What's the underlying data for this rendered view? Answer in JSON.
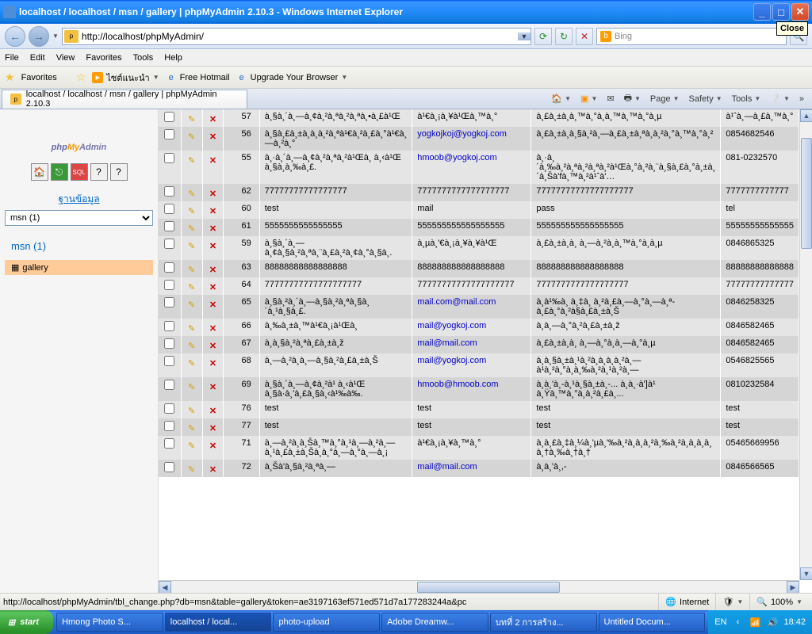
{
  "window": {
    "title": "localhost / localhost / msn / gallery | phpMyAdmin 2.10.3 - Windows Internet Explorer",
    "close_tip": "Close"
  },
  "nav": {
    "url": "http://localhost/phpMyAdmin/",
    "search_provider": "Bing"
  },
  "menu": {
    "file": "File",
    "edit": "Edit",
    "view": "View",
    "favorites": "Favorites",
    "tools": "Tools",
    "help": "Help"
  },
  "favbar": {
    "favorites": "Favorites",
    "suggested": "ไซต์แนะนำ",
    "hotmail": "Free Hotmail",
    "upgrade": "Upgrade Your Browser"
  },
  "tab": {
    "title": "localhost / localhost / msn / gallery | phpMyAdmin 2.10.3"
  },
  "cmdbar": {
    "page": "Page",
    "safety": "Safety",
    "tools": "Tools"
  },
  "sidebar": {
    "db_label": "ฐานข้อมูล",
    "db_selected": "msn (1)",
    "link": "msn (1)",
    "table": "gallery"
  },
  "rows": [
    {
      "id": "57",
      "c1": "à¸§à¸´à¸—à¸¢à¸²à¸ªà¸²à¸ªà¸•à¸£à¹Œ",
      "c2": "à¹€à¸¡à¸¥à¹Œà¸™à¸°",
      "c3": "à¸£à¸±à¸à¸™à¸°à¸à¸™à¸™à¸°à¸µ",
      "c4": "à¹ˆà¸—à¸£à¸™à¸°"
    },
    {
      "id": "56",
      "c1": "à¸§à¸£à¸±à¸à¸à¸²à¸ªà¹€à¸²à¸£à¸°à¹€à¸—à¸²à¸°",
      "c2": "yogkojkoj@yogkoj.com",
      "c3": "à¸£à¸±à¸à¸§à¸²à¸—à¸£à¸±à¸ªà¸à¸²à¸°à¸™à¸°à¸²",
      "c4": "0854682546"
    },
    {
      "id": "55",
      "c1": "à¸·à¸´à¸—à¸¢à¸²à¸ªà¸²à¹Œà¸ à¸‹à¹Œ à¸§à¸à¸‰à¸£.",
      "c2": "hmoob@yogkoj.com",
      "c3": "à¸·à¸´à¸‰à¸²à¸ªà¸²à¸ªà¸²à¹Œà¸°à¸²à¸¨à¸§à¸£à¸°à¸±à¸´à¸Šà'fà¸™à¸²à¹ˆà'…",
      "c4": "081-0232570"
    },
    {
      "id": "62",
      "c1": "77777777777777777",
      "c2": "7777777777777777777",
      "c3": "77777777777777777777",
      "c4": "7777777777777"
    },
    {
      "id": "60",
      "c1": "test",
      "c2": "mail",
      "c3": "pass",
      "c4": "tel"
    },
    {
      "id": "61",
      "c1": "5555555555555555",
      "c2": "555555555555555555",
      "c3": "555555555555555555",
      "c4": "55555555555555"
    },
    {
      "id": "59",
      "c1": "à¸§à¸´à¸—à¸¢à¸§à¸²à¸ªà¸¨à¸£à¸²à¸¢à¸°à¸§à¸.",
      "c2": "à¸µà¸'€à¸¡à¸¥à¸¥à¹Œ",
      "c3": "à¸£à¸±à¸à¸ à¸—à¸²à¸à¸™à¸°à¸à¸µ",
      "c4": "0846865325"
    },
    {
      "id": "63",
      "c1": "88888888888888888",
      "c2": "888888888888888888",
      "c3": "888888888888888888",
      "c4": "88888888888888"
    },
    {
      "id": "64",
      "c1": "77777777777777777777",
      "c2": "77777777777777777777",
      "c3": "7777777777777777777",
      "c4": "77777777777777"
    },
    {
      "id": "65",
      "c1": "à¸§à¸²à¸´à¸—à¸§à¸²à¸ªà¸§à¸´à¸¹à¸§à¸£.",
      "c2": "mail.com@mail.com",
      "c3": "à¸à¹‰à¸ à¸‡à¸ à¸²à¸£à¸—à¸°à¸—à¸ª-à¸£à¸°à¸²à§à¸£à¸±à¸Š",
      "c4": "0846258325"
    },
    {
      "id": "66",
      "c1": "à¸‰à¸±à¸™à¹€à¸¡à¹Œà¸",
      "c2": "mail@yogkoj.com",
      "c3": "à¸à¸—à¸°à¸²à¸£à¸±à¸ž",
      "c4": "0846582465"
    },
    {
      "id": "67",
      "c1": "à¸à¸§à¸²à¸ªà¸£à¸±à¸ž",
      "c2": "mail@mail.com",
      "c3": "à¸£à¸±à¸à¸ à¸—à¸°à¸à¸—à¸°à¸µ",
      "c4": "0846582465"
    },
    {
      "id": "68",
      "c1": "à¸—à¸²à¸à¸—à¸§à¸²à¸£à¸±à¸Š",
      "c2": "mail@yogkoj.com",
      "c3": "à¸à¸§à¸±à¸¹à¸²à¸à¸à¸à¸²à¸—à¹à¸²à¸°à¸à¸‰à¸²à¸¹à¸²à¸—",
      "c4": "0546825565"
    },
    {
      "id": "69",
      "c1": "à¸§à¸´à¸—à¸¢à¸²à¹ à¸‹à¹Œ à¸§à·à¸'à¸£à¸§à¸‹à¹‰à‰.",
      "c2": "hmoob@hmoob.com",
      "c3": "à¸à¸'à¸-à¸¹à¸§à¸±à¸-... à¸à¸·à']à¹ à¸Ÿà¸™à¸°à¸à¸²à¸£à¸...",
      "c4": "0810232584"
    },
    {
      "id": "76",
      "c1": "test",
      "c2": "test",
      "c3": "test",
      "c4": "test"
    },
    {
      "id": "77",
      "c1": "test",
      "c2": "test",
      "c3": "test",
      "c4": "test"
    },
    {
      "id": "71",
      "c1": "à¸—à¸²à¸à¸Šà¸™à¸°à¸¹à¸—à¸²à¸—à¸¹à¸£à¸±à¸Šà¸à¸°à¸—à¸°à¸—à¸¡",
      "c2": "à¹€à¸¡à¸¥à¸™à¸°",
      "c3": "à¸à¸£à¸‡à¸¼à¸'µà¸'‰à¸²à¸à¸à¸²à¸‰à¸²à¸à¸à¸à¸ à¸†à¸‰à¸†à¸†",
      "c4": "05465669956"
    },
    {
      "id": "72",
      "c1": "à¸Šà'à¸§à¸²à¸ªà¸—",
      "c2": "mail@mail.com",
      "c3": "à¸à¸'à¸,-",
      "c4": "0846566565"
    }
  ],
  "status": {
    "url": "http://localhost/phpMyAdmin/tbl_change.php?db=msn&table=gallery&token=ae3197163ef571ed571d7a177283244a&pc",
    "zone": "Internet",
    "zoom": "100%"
  },
  "taskbar": {
    "start": "start",
    "items": [
      "Hmong Photo S...",
      "localhost / local...",
      "photo-upload",
      "Adobe Dreamw...",
      "บทที่ 2 การสร้าง...",
      "Untitled Docum..."
    ],
    "lang": "EN",
    "time": "18:42"
  }
}
